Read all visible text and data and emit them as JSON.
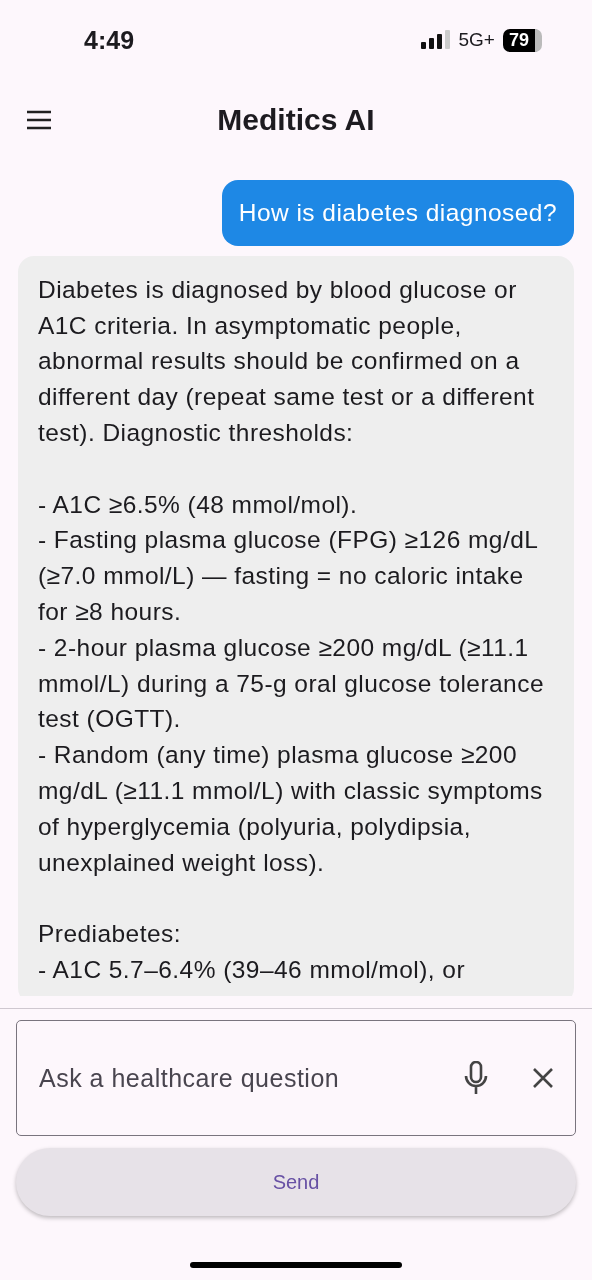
{
  "status_bar": {
    "time": "4:49",
    "network": "5G+",
    "battery": "79"
  },
  "app_bar": {
    "title": "Meditics AI"
  },
  "messages": [
    {
      "kind": "user",
      "sections": [
        [
          "How is diabetes diagnosed?"
        ]
      ]
    },
    {
      "kind": "assistant",
      "sections": [
        [
          "Diabetes is diagnosed by blood glucose or A1C criteria. In asymptomatic people, abnormal results should be confirmed on a different day (repeat same test or a different test). Diagnostic thresholds:"
        ],
        [
          "- A1C ≥6.5% (48 mmol/mol).",
          "- Fasting plasma glucose (FPG) ≥126 mg/dL (≥7.0 mmol/L) — fasting = no caloric intake for ≥8 hours.",
          "- 2-hour plasma glucose ≥200 mg/dL (≥11.1 mmol/L) during a 75-g oral glucose tolerance test (OGTT).",
          "- Random (any time) plasma glucose ≥200 mg/dL (≥11.1 mmol/L) with classic symptoms of hyperglycemia (polyuria, polydipsia, unexplained weight loss)."
        ],
        [
          "Prediabetes:",
          "- A1C 5.7–6.4% (39–46 mmol/mol), or"
        ]
      ]
    }
  ],
  "composer": {
    "placeholder": "Ask a healthcare question",
    "send_label": "Send"
  }
}
